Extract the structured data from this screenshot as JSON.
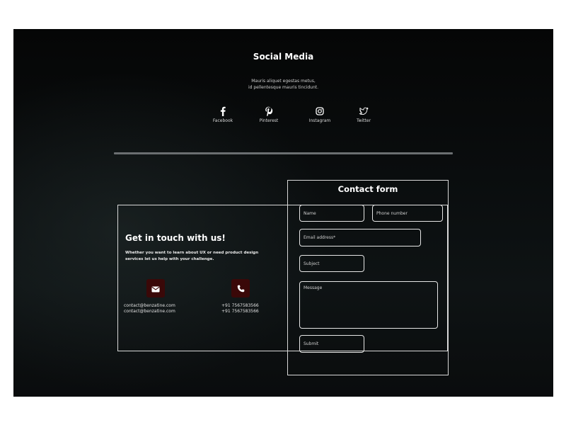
{
  "social": {
    "title": "Social Media",
    "description_line1": "Mauris aliquet egestas metus,",
    "description_line2": "id pellentesque mauris tincidunt.",
    "items": [
      {
        "label": "Facebook",
        "icon": "facebook-icon"
      },
      {
        "label": "Pinterest",
        "icon": "pinterest-icon"
      },
      {
        "label": "Instagram",
        "icon": "instagram-icon"
      },
      {
        "label": "Twitter",
        "icon": "twitter-icon"
      }
    ]
  },
  "touch": {
    "title": "Get in touch with us!",
    "description_line1": "Whether you want to learn about UX or need product design",
    "description_line2": "services let us help with your challenge.",
    "email": {
      "icon": "mail-icon",
      "line1": "contact@benzatine.com",
      "line2": "contact@benzatine.com"
    },
    "phone": {
      "icon": "phone-icon",
      "line1": "+91 7567583566",
      "line2": "+91 7567583566"
    }
  },
  "form": {
    "title": "Contact form",
    "name_placeholder": "Name",
    "phone_placeholder": "Phone number",
    "email_placeholder": "Email address*",
    "subject_placeholder": "Subject",
    "message_placeholder": "Message",
    "submit_label": "Submit"
  },
  "colors": {
    "background": "#0a0d0e",
    "icon_box": "#3a0808",
    "border": "#d8d8d8",
    "text": "#ffffff"
  }
}
